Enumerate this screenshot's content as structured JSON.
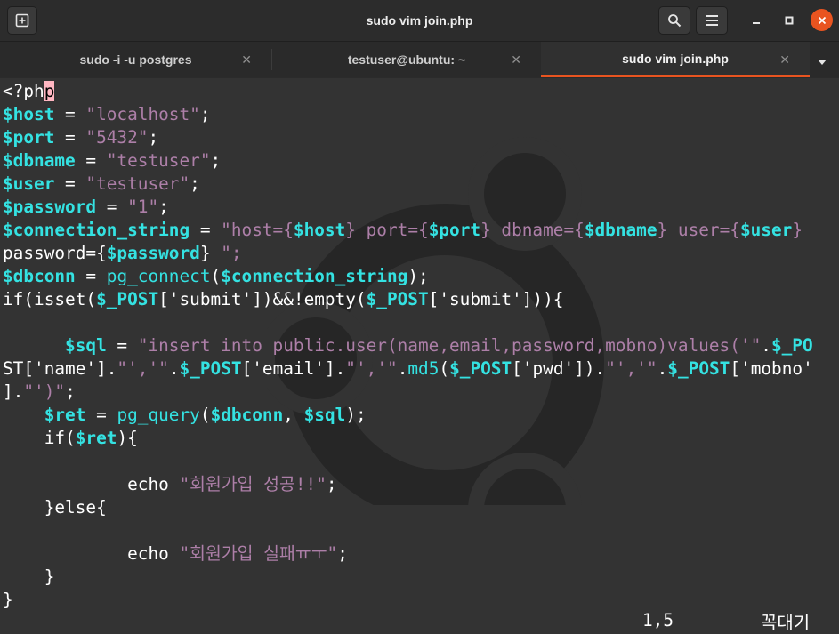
{
  "window": {
    "title": "sudo vim join.php"
  },
  "tabs": [
    {
      "label": "sudo -i -u postgres",
      "active": false
    },
    {
      "label": "testuser@ubuntu: ~",
      "active": false
    },
    {
      "label": "sudo vim join.php",
      "active": true
    }
  ],
  "icons": {
    "new_tab": "new-tab-icon",
    "search": "search-icon",
    "menu": "hamburger-menu-icon",
    "minimize": "minimize-icon",
    "maximize": "maximize-icon",
    "close": "close-icon",
    "tab_dropdown": "chevron-down-icon"
  },
  "colors": {
    "accent": "#e95420",
    "variable": "#34e2e2",
    "string": "#ad7fa8",
    "text": "#ffffff"
  },
  "editor": {
    "lines": [
      "<?php",
      "$host = \"localhost\";",
      "$port = \"5432\";",
      "$dbname = \"testuser\";",
      "$user = \"testuser\";",
      "$password = \"1\";",
      "$connection_string = \"host={$host} port={$port} dbname={$dbname} user={$user}",
      "password={$password} \";",
      "$dbconn = pg_connect($connection_string);",
      "if(isset($_POST['submit'])&&!empty($_POST['submit'])){",
      "",
      "      $sql = \"insert into public.user(name,email,password,mobno)values('\".$_PO",
      "ST['name'].\"','\".$_POST['email'].\"','\".md5($_POST['pwd']).\"','\".$_POST['mobno'",
      "].\"')\";",
      "    $ret = pg_query($dbconn, $sql);",
      "    if($ret){",
      "",
      "            echo \"회원가입 성공!!\";",
      "    }else{",
      "",
      "            echo \"회원가입 실패ㅠㅜ\";",
      "    }",
      "}"
    ],
    "cursor_position": "1,5",
    "status_text": "꼭대기"
  }
}
